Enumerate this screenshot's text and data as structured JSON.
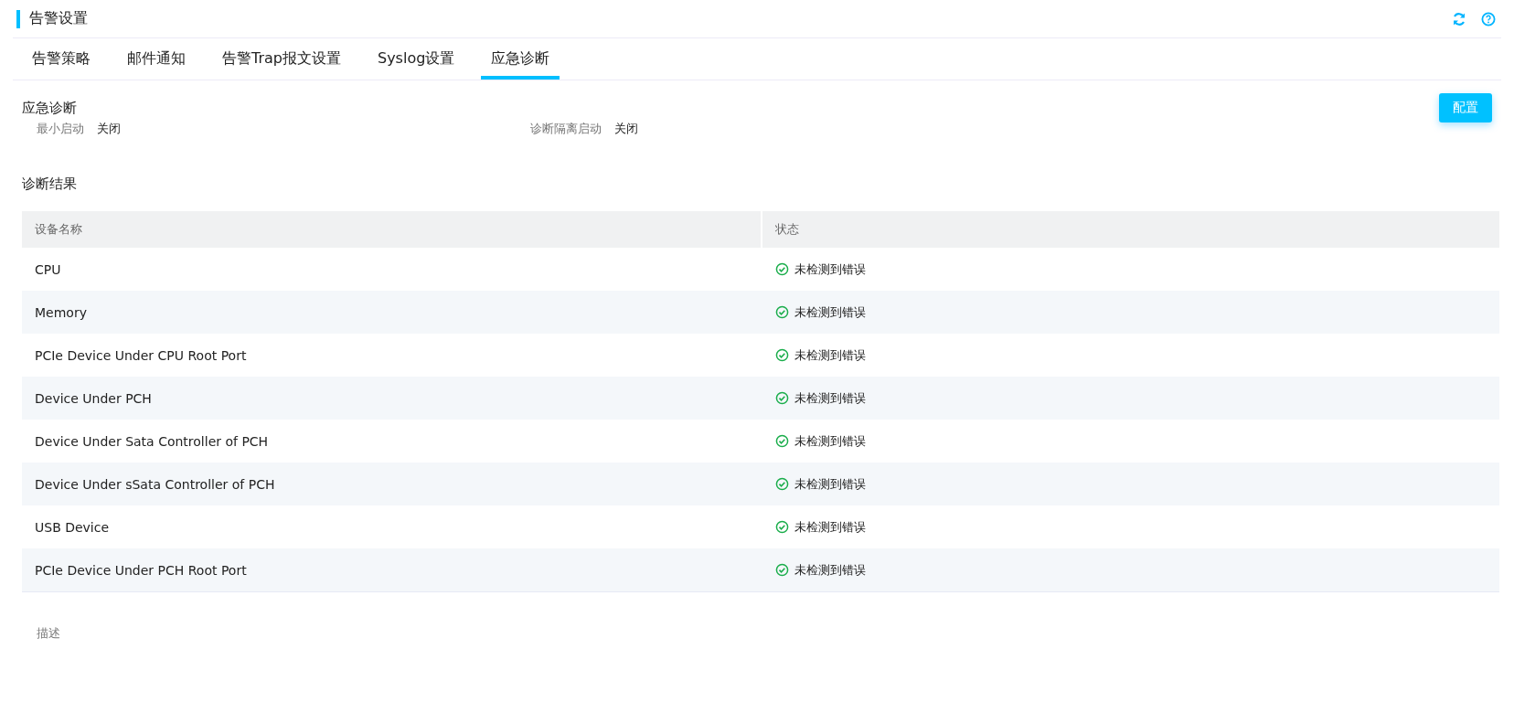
{
  "header": {
    "title": "告警设置"
  },
  "tabs": [
    {
      "label": "告警策略",
      "selected": false
    },
    {
      "label": "邮件通知",
      "selected": false
    },
    {
      "label": "告警Trap报文设置",
      "selected": false
    },
    {
      "label": "Syslog设置",
      "selected": false
    },
    {
      "label": "应急诊断",
      "selected": true
    }
  ],
  "diagnosis": {
    "title": "应急诊断",
    "button": "配置",
    "fields": [
      {
        "label": "最小启动",
        "value": "关闭"
      },
      {
        "label": "诊断隔离启动",
        "value": "关闭"
      }
    ]
  },
  "results": {
    "title": "诊断结果",
    "columns": [
      "设备名称",
      "状态"
    ],
    "rows": [
      {
        "device": "CPU",
        "status": "未检测到错误",
        "kind": "ok"
      },
      {
        "device": "Memory",
        "status": "未检测到错误",
        "kind": "ok"
      },
      {
        "device": "PCIe Device Under CPU Root Port",
        "status": "未检测到错误",
        "kind": "ok"
      },
      {
        "device": "Device Under PCH",
        "status": "未检测到错误",
        "kind": "ok"
      },
      {
        "device": "Device Under Sata Controller of PCH",
        "status": "未检测到错误",
        "kind": "ok"
      },
      {
        "device": "Device Under sSata Controller of PCH",
        "status": "未检测到错误",
        "kind": "ok"
      },
      {
        "device": "USB Device",
        "status": "未检测到错误",
        "kind": "ok"
      },
      {
        "device": "PCIe Device Under PCH Root Port",
        "status": "未检测到错误",
        "kind": "ok"
      }
    ]
  },
  "description": {
    "label": "描述"
  }
}
